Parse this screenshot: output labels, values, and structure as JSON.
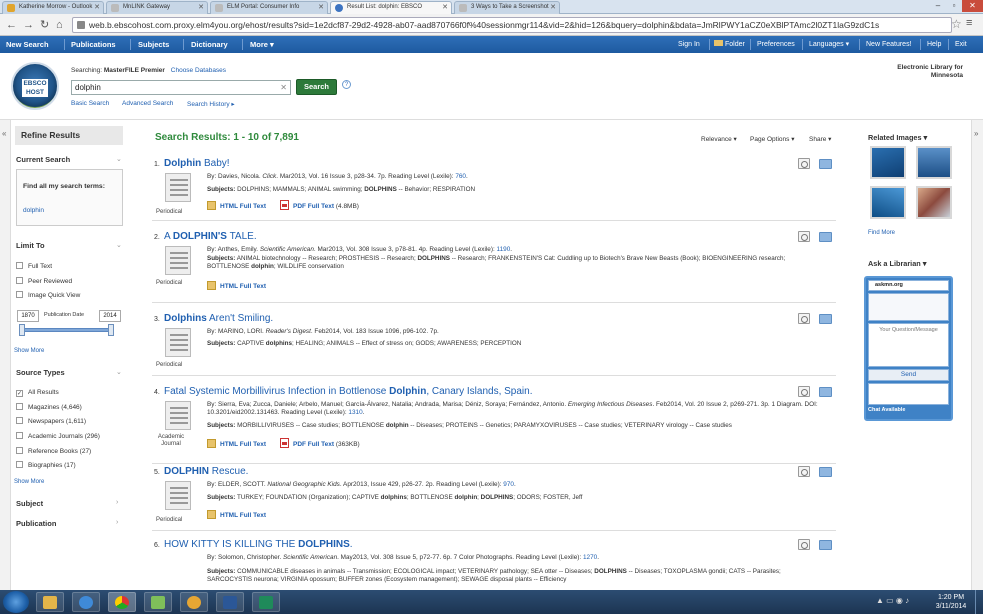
{
  "browser": {
    "tabs": [
      {
        "label": "Katherine Morrow - Outlook",
        "color": "#e0a52e"
      },
      {
        "label": "MnLINK Gateway",
        "color": "#d0d0d0"
      },
      {
        "label": "ELM Portal: Consumer Info",
        "color": "#d0d0d0"
      },
      {
        "label": "Result List: dolphin: EBSCO",
        "color": "#3d74c1"
      },
      {
        "label": "3 Ways to Take a Screenshot",
        "color": "#d0d0d0"
      }
    ],
    "url": "web.b.ebscohost.com.proxy.elm4you.org/ehost/results?sid=1e2dcf87-29d2-4928-ab07-aad870766f0f%40sessionmgr114&vid=2&hid=126&bquery=dolphin&bdata=JmRlPWY1aCZ0eXBlPTAmc2l0ZT1laG9zdC1s"
  },
  "toolbar": {
    "left": [
      "New Search",
      "Publications",
      "Subjects",
      "Dictionary",
      "More ▾"
    ],
    "right": [
      "Sign In",
      "Folder",
      "Preferences",
      "Languages ▾",
      "New Features!",
      "Help",
      "Exit"
    ]
  },
  "header": {
    "logo_text": "EBSCO HOST",
    "searching_label": "Searching:",
    "database": "MasterFILE Premier",
    "choose_db": "Choose Databases",
    "query": "dolphin",
    "search_button": "Search",
    "basic_search": "Basic Search",
    "advanced_search": "Advanced Search",
    "search_history": "Search History ▸",
    "library_name": "Electronic Library for Minnesota"
  },
  "left": {
    "refine": "Refine Results",
    "current_search": "Current Search",
    "find_label": "Find all my search terms:",
    "find_term": "dolphin",
    "limit_to": "Limit To",
    "limits": [
      "Full Text",
      "Peer Reviewed",
      "Image Quick View"
    ],
    "date_from": "1870",
    "date_label": "Publication Date",
    "date_to": "2014",
    "show_more": "Show More",
    "source_types": "Source Types",
    "sources": [
      {
        "label": "All Results",
        "checked": true
      },
      {
        "label": "Magazines (4,646)",
        "checked": false
      },
      {
        "label": "Newspapers (1,611)",
        "checked": false
      },
      {
        "label": "Academic Journals (296)",
        "checked": false
      },
      {
        "label": "Reference Books (27)",
        "checked": false
      },
      {
        "label": "Biographies (17)",
        "checked": false
      }
    ],
    "show_more2": "Show More",
    "subject": "Subject",
    "publication": "Publication"
  },
  "main": {
    "results_title": "Search Results: 1 - 10 of 7,891",
    "relevance": "Relevance ▾",
    "page_options": "Page Options ▾",
    "share": "Share ▾",
    "results": [
      {
        "num": "1.",
        "title_html": "<b>Dolphin</b> Baby!",
        "type": "Periodical",
        "byline": "By: Davies, Nicola. <i>Click</i>. Mar2013, Vol. 16 Issue 3, p28-34. 7p. Reading Level (Lexile): <span class=\"lex\">760</span>.",
        "subjects": "<b>Subjects:</b> DOLPHINS; MAMMALS; ANIMAL swimming; <b>DOLPHINS</b> -- Behavior; RESPIRATION",
        "html_ft": "HTML Full Text",
        "pdf_ft": "PDF Full Text",
        "pdf_size": "(4.8MB)"
      },
      {
        "num": "2.",
        "title_html": "A <b>DOLPHIN'S</b> TALE.",
        "type": "Periodical",
        "byline": "By: Anthes, Emily. <i>Scientific American</i>. Mar2013, Vol. 308 Issue 3, p78-81. 4p. Reading Level (Lexile): <span class=\"lex\">1190</span>.",
        "subjects": "<b>Subjects:</b> ANIMAL biotechnology -- Research; PROSTHESIS -- Research; <b>DOLPHINS</b> -- Research; FRANKENSTEIN'S Cat: Cuddling up to Biotech's Brave New Beasts (Book); BIOENGINEERING research; BOTTLENOSE <b>dolphin</b>; WILDLIFE conservation",
        "html_ft": "HTML Full Text",
        "pdf_ft": "",
        "pdf_size": ""
      },
      {
        "num": "3.",
        "title_html": "<b>Dolphins</b> Aren't Smiling.",
        "type": "Periodical",
        "byline": "By: MARINO, LORI. <i>Reader's Digest</i>. Feb2014, Vol. 183 Issue 1096, p96-102. 7p.",
        "subjects": "<b>Subjects:</b> CAPTIVE <b>dolphins</b>; HEALING; ANIMALS -- Effect of stress on; GODS; AWARENESS; PERCEPTION",
        "html_ft": "",
        "pdf_ft": "",
        "pdf_size": ""
      },
      {
        "num": "4.",
        "title_html": "Fatal Systemic Morbillivirus Infection in Bottlenose <b>Dolphin</b>, Canary Islands, Spain.",
        "type": "Academic Journal",
        "byline": "By: Sierra, Eva; Zucca, Daniele; Arbelo, Manuel; García-Álvarez, Natalia; Andrada, Marisa; Déniz, Soraya; Fernández, Antonio. <i>Emerging Infectious Diseases</i>. Feb2014, Vol. 20 Issue 2, p269-271. 3p. 1 Diagram. DOI: 10.3201/eid2002.131463. Reading Level (Lexile): <span class=\"lex\">1310</span>.",
        "subjects": "<b>Subjects:</b> MORBILLIVIRUSES -- Case studies; BOTTLENOSE <b>dolphin</b> -- Diseases; PROTEINS -- Genetics; PARAMYXOVIRUSES -- Case studies; VETERINARY virology -- Case studies",
        "html_ft": "HTML Full Text",
        "pdf_ft": "PDF Full Text",
        "pdf_size": "(363KB)"
      },
      {
        "num": "5.",
        "title_html": "<b>DOLPHIN</b> Rescue.",
        "type": "Periodical",
        "byline": "By: ELDER, SCOTT. <i>National Geographic Kids</i>. Apr2013, Issue 429, p26-27. 2p. Reading Level (Lexile): <span class=\"lex\">970</span>.",
        "subjects": "<b>Subjects:</b> TURKEY; FOUNDATION (Organization); CAPTIVE <b>dolphins</b>; BOTTLENOSE <b>dolphin</b>; <b>DOLPHINS</b>; ODORS; FOSTER, Jeff",
        "html_ft": "HTML Full Text",
        "pdf_ft": "",
        "pdf_size": ""
      },
      {
        "num": "6.",
        "title_html": "HOW KITTY IS KILLING THE <b>DOLPHINS</b>.",
        "type": "",
        "byline": "By: Solomon, Christopher. <i>Scientific American</i>. May2013, Vol. 308 Issue 5, p72-77. 6p. 7 Color Photographs. Reading Level (Lexile): <span class=\"lex\">1270</span>.",
        "subjects": "<b>Subjects:</b> COMMUNICABLE diseases in animals -- Transmission; ECOLOGICAL impact; VETERINARY pathology; SEA otter -- Diseases; <b>DOLPHINS</b> -- Diseases; TOXOPLASMA gondii; CATS -- Parasites; SARCOCYSTIS neurona; VIRGINIA opossum; BUFFER zones (Ecosystem management); SEWAGE disposal plants -- Efficiency",
        "html_ft": "",
        "pdf_ft": "",
        "pdf_size": ""
      }
    ]
  },
  "right": {
    "related_images": "Related Images ▾",
    "find_more": "Find More",
    "ask_librarian": "Ask a Librarian ▾",
    "chat_service": "askmn.org",
    "question_placeholder": "Your Question/Message",
    "send": "Send",
    "chat_status": "Chat Available"
  },
  "taskbar": {
    "time": "1:20 PM",
    "date": "3/11/2014"
  }
}
